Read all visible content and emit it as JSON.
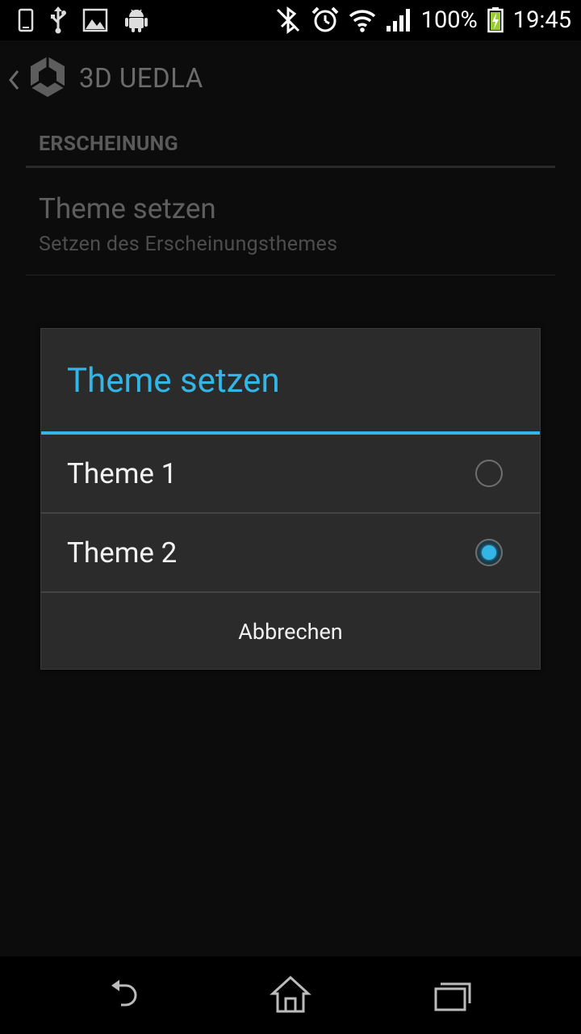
{
  "status_bar": {
    "left_icons": [
      "phone-icon",
      "usb-icon",
      "image-icon",
      "android-icon"
    ],
    "right_icons": [
      "bluetooth-off-icon",
      "alarm-icon",
      "wifi-icon",
      "signal-icon",
      "battery-charging-icon"
    ],
    "battery_percent": "100%",
    "time": "19:45"
  },
  "action_bar": {
    "title": "3D UEDLA",
    "logo": "unity-logo"
  },
  "preferences": {
    "category": "ERSCHEINUNG",
    "item": {
      "title": "Theme setzen",
      "summary": "Setzen des Erscheinungsthemes"
    }
  },
  "dialog": {
    "title": "Theme setzen",
    "options": [
      {
        "label": "Theme 1",
        "selected": false
      },
      {
        "label": "Theme 2",
        "selected": true
      }
    ],
    "cancel_label": "Abbrechen"
  },
  "nav_bar": {
    "buttons": [
      "back-icon",
      "home-icon",
      "recent-apps-icon"
    ]
  },
  "colors": {
    "accent": "#33b5e5",
    "dialog_bg": "#2b2b2b",
    "app_bg": "#0c0c0c"
  }
}
